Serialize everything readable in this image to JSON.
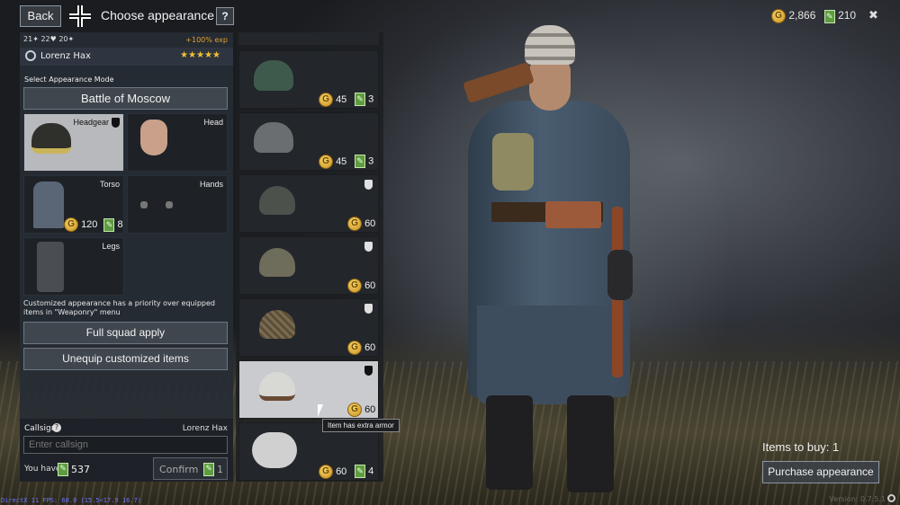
{
  "header": {
    "back_label": "Back",
    "title": "Choose appearance",
    "help_label": "?",
    "gold": "2,866",
    "tickets": "210",
    "close_label": "✖"
  },
  "soldier": {
    "stat1": "21",
    "stat2": "22",
    "stat3": "20",
    "exp": "+100% exp",
    "name": "Lorenz Hax",
    "stars": "★★★★★"
  },
  "mode": {
    "label": "Select Appearance Mode",
    "value": "Battle of Moscow"
  },
  "slots": {
    "headgear": "Headgear",
    "head": "Head",
    "torso": "Torso",
    "hands": "Hands",
    "legs": "Legs",
    "torso_gold": "120",
    "torso_tickets": "8"
  },
  "notice": "Customized appearance has a priority over equipped items in \"Weaponry\" menu",
  "buttons": {
    "squad": "Full squad apply",
    "unequip": "Unequip customized items",
    "confirm": "Confirm",
    "confirm_tickets": "1"
  },
  "callsign": {
    "label": "Callsign",
    "help": "?",
    "name": "Lorenz Hax",
    "placeholder": "Enter callsign",
    "you_have": "You have",
    "tickets": "537"
  },
  "items": [
    {
      "gold": "45",
      "tickets": "3"
    },
    {
      "gold": "45",
      "tickets": "3"
    },
    {
      "gold": "60"
    },
    {
      "gold": "60"
    },
    {
      "gold": "60"
    },
    {
      "gold": "60"
    },
    {
      "gold": "60",
      "tickets": "4"
    }
  ],
  "tooltip": "Item has extra armor",
  "buy": {
    "count_label": "Items to buy: 1",
    "purchase": "Purchase appearance"
  },
  "footer": {
    "fps": "DirectX 11 FPS: 60.0 (15.5<17.9 16.7)",
    "version": "Version: 0.7.5.1"
  }
}
